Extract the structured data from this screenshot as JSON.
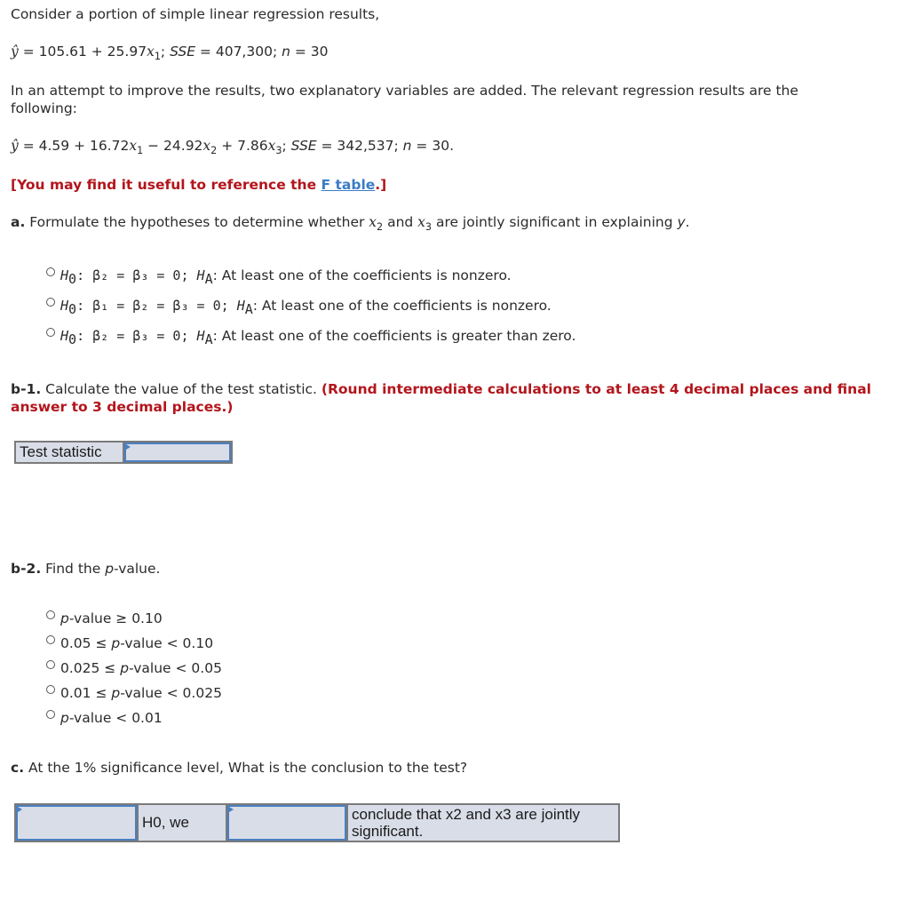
{
  "intro": "Consider a portion of simple linear regression results,",
  "simple_model": {
    "yhat": "ŷ",
    "eq": " = 105.61 + 25.97",
    "x": "x",
    "sub1": "1",
    "semi": "; ",
    "sse_label": "SSE",
    "sse_val": " = 407,300; ",
    "n_label": "n",
    "n_val": " = 30"
  },
  "improve_text_line1": "In an attempt to improve the results, two explanatory variables are added. The relevant regression results are the",
  "improve_text_line2": "following:",
  "multi_model": {
    "yhat": "ŷ",
    "p1": " = 4.59 + 16.72",
    "x": "x",
    "s1": "1",
    "p2": " − 24.92",
    "s2": "2",
    "p3": " + 7.86",
    "s3": "3",
    "semi": "; ",
    "sse_label": "SSE",
    "sse_val": " = 342,537; ",
    "n_label": "n",
    "n_val": " = 30."
  },
  "reference": {
    "prefix": "[You may find it useful to reference the ",
    "link": "F table",
    "suffix": ".]"
  },
  "part_a": {
    "label": "a.",
    "text1": " Formulate the hypotheses to determine whether ",
    "x": "x",
    "s2": "2",
    "and": " and ",
    "s3": "3",
    "text2": " are jointly significant in explaining ",
    "y": "y",
    "period": ".",
    "options": [
      {
        "h0": "H",
        "h0sub": "0",
        "expr": ": β₂ = β₃ = 0; ",
        "ha": "H",
        "hasub": "A",
        "rest": ": At least one of the coefficients is nonzero."
      },
      {
        "h0": "H",
        "h0sub": "0",
        "expr": ": β₁ = β₂ = β₃ = 0; ",
        "ha": "H",
        "hasub": "A",
        "rest": ": At least one of the coefficients is nonzero."
      },
      {
        "h0": "H",
        "h0sub": "0",
        "expr": ": β₂ = β₃ = 0; ",
        "ha": "H",
        "hasub": "A",
        "rest": ": At least one of the coefficients is greater than zero."
      }
    ]
  },
  "part_b1": {
    "label": "b-1.",
    "text": " Calculate the value of the test statistic. ",
    "instr_line1": "(Round intermediate calculations to at least 4 decimal places and final",
    "instr_line2": "answer to 3 decimal places.)",
    "field_label": "Test statistic",
    "field_value": ""
  },
  "part_b2": {
    "label": "b-2.",
    "text1": " Find the ",
    "p": "p",
    "text2": "-value.",
    "options": [
      {
        "pre": "",
        "p": "p",
        "post": "-value ≥ 0.10"
      },
      {
        "pre": "0.05 ≤ ",
        "p": "p",
        "post": "-value < 0.10"
      },
      {
        "pre": "0.025 ≤ ",
        "p": "p",
        "post": "-value < 0.05"
      },
      {
        "pre": "0.01 ≤ ",
        "p": "p",
        "post": "-value < 0.025"
      },
      {
        "pre": "",
        "p": "p",
        "post": "-value < 0.01"
      }
    ]
  },
  "part_c": {
    "label": "c.",
    "text": " At the 1% significance level, What is the conclusion to the test?",
    "dropdown1_value": "",
    "mid_text": "H0, we",
    "dropdown2_value": "",
    "end_text_line1": "conclude that x2 and x3 are jointly",
    "end_text_line2": "significant."
  }
}
